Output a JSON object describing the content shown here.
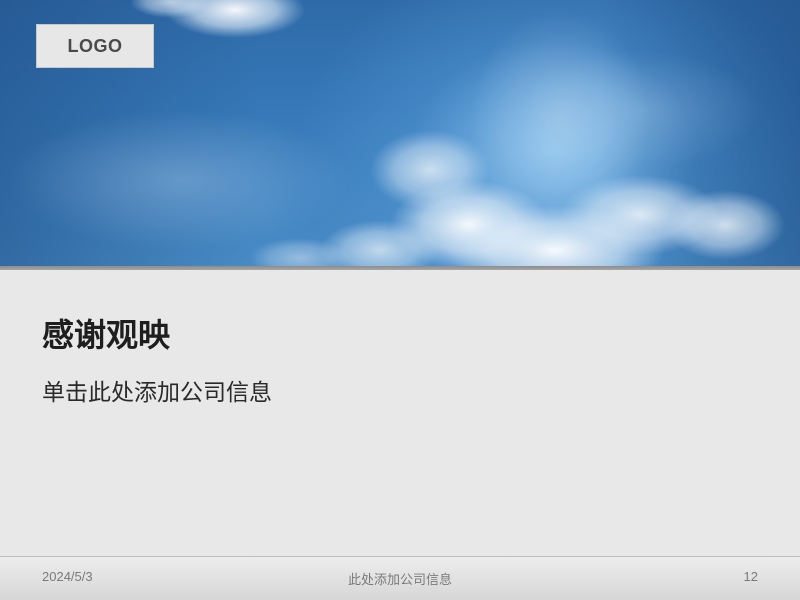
{
  "logo": {
    "label": "LOGO"
  },
  "slide": {
    "title": "感谢观映",
    "subtitle": "单击此处添加公司信息"
  },
  "footer": {
    "date": "2024/5/3",
    "center_text": "此处添加公司信息",
    "page_number": "12"
  },
  "colors": {
    "sky_blue": "#3576b6",
    "content_background": "#e8e8e8",
    "divider_gray": "#8d8d8d",
    "footer_text": "#7a7a7a",
    "title_text": "#1e1e1e"
  }
}
